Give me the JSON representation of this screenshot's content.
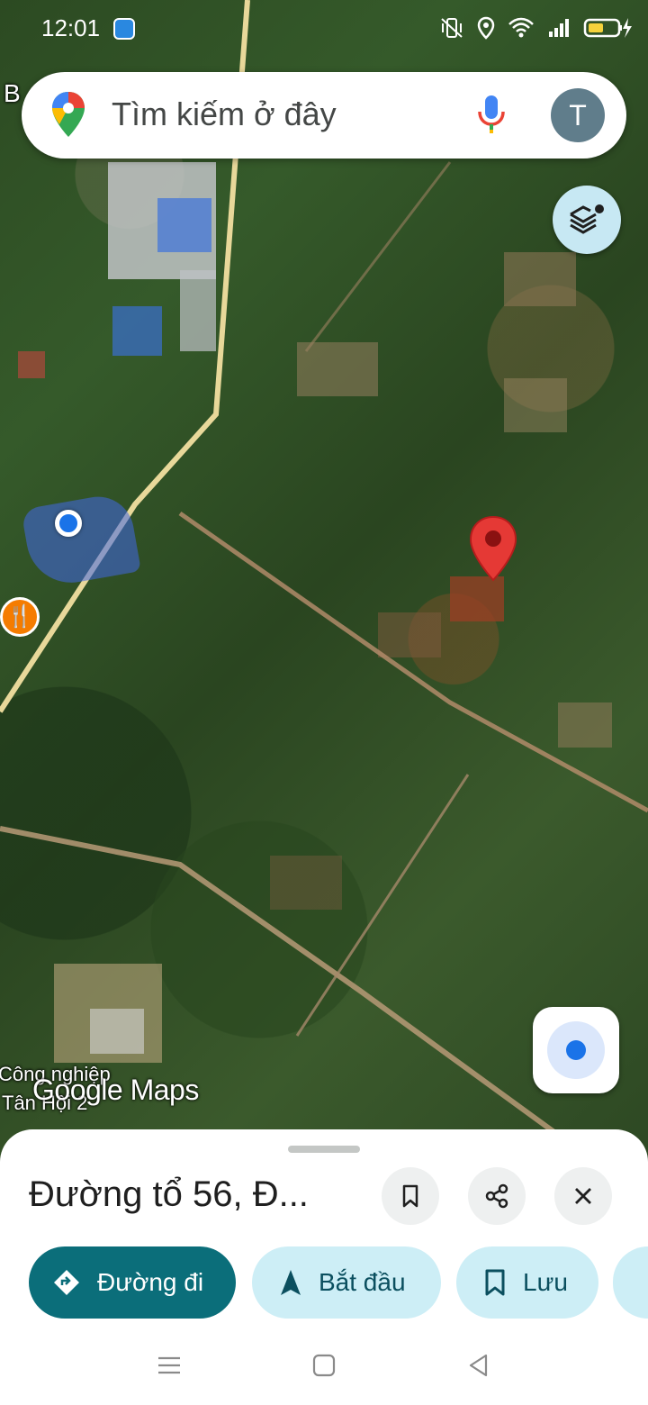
{
  "status_bar": {
    "time": "12:01"
  },
  "search": {
    "placeholder": "Tìm kiếm ở đây",
    "avatar_initial": "T"
  },
  "map": {
    "area_label_line1": "Công nghiệp",
    "area_label_line2": "Tân Hội 2",
    "partial_label": "B",
    "logo_text": "Google Maps"
  },
  "place": {
    "title": "Đường tổ 56, Đ..."
  },
  "actions": {
    "directions_label": "Đường đi",
    "start_label": "Bắt đầu",
    "save_label": "Lưu"
  },
  "colors": {
    "primary_chip": "#0b6e7a",
    "secondary_chip": "#cdeef6",
    "pin_red": "#e53935",
    "location_blue": "#1a73e8"
  }
}
